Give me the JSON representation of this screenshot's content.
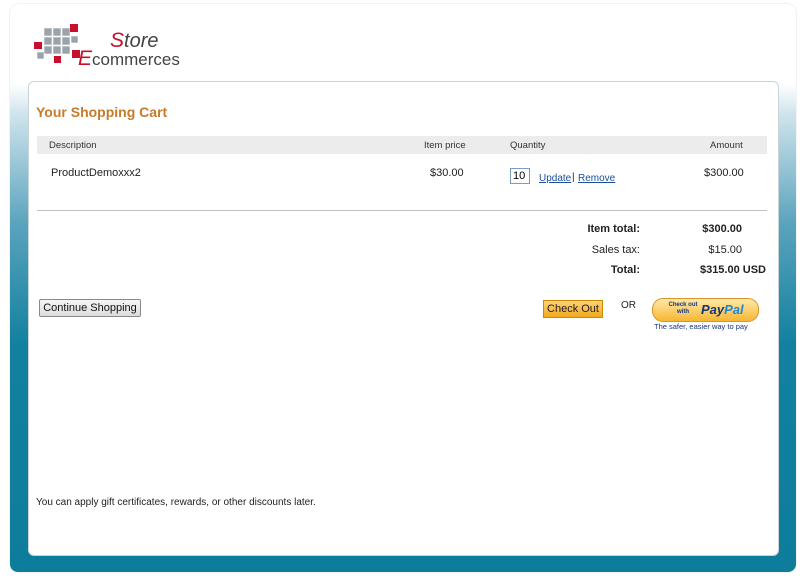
{
  "logo": {
    "word1_cap": "S",
    "word1_rest": "tore",
    "word2_cap": "E",
    "word2_rest": "commerces"
  },
  "cart": {
    "title": "Your Shopping Cart",
    "columns": [
      "Description",
      "Item price",
      "Quantity",
      "Amount"
    ],
    "items": [
      {
        "description": "ProductDemoxxx2",
        "price": "$30.00",
        "quantity": "10",
        "amount": "$300.00",
        "update_label": "Update",
        "separator": "|",
        "remove_label": "Remove"
      }
    ],
    "totals": {
      "item_total_label": "Item total:",
      "item_total_value": "$300.00",
      "sales_tax_label": "Sales tax:",
      "sales_tax_value": "$15.00",
      "total_label": "Total:",
      "total_value": "$315.00 USD"
    },
    "buttons": {
      "continue": "Continue Shopping",
      "checkout": "Check Out",
      "or": "OR",
      "paypal_small": "Check out with",
      "paypal_logo_a": "Pay",
      "paypal_logo_b": "Pal",
      "paypal_tagline": "The safer, easier way to pay"
    },
    "footnote": "You can apply gift certificates, rewards, or other discounts later."
  },
  "colors": {
    "title": "#c77a2a",
    "logo_accent": "#c8102e",
    "background_teal": "#0e7c9b",
    "link": "#1a4fa0"
  }
}
